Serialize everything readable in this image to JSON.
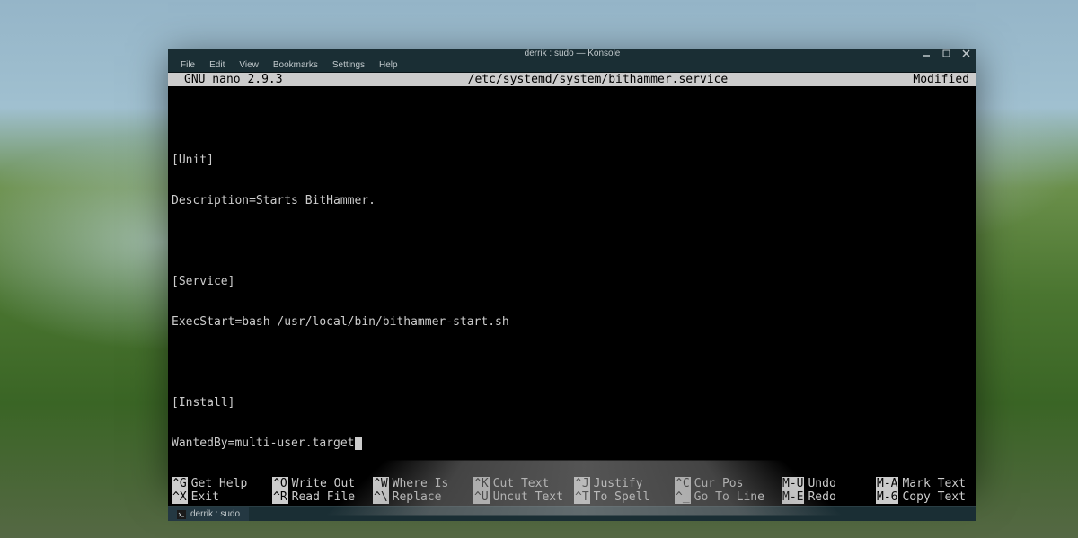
{
  "window": {
    "title": "derrik : sudo — Konsole"
  },
  "menubar": {
    "items": [
      "File",
      "Edit",
      "View",
      "Bookmarks",
      "Settings",
      "Help"
    ]
  },
  "nano": {
    "header": {
      "version": "GNU nano 2.9.3",
      "filename": "/etc/systemd/system/bithammer.service",
      "status": "Modified"
    },
    "content": {
      "lines": [
        "",
        "[Unit]",
        "Description=Starts BitHammer.",
        "",
        "[Service]",
        "ExecStart=bash /usr/local/bin/bithammer-start.sh",
        "",
        "[Install]",
        "WantedBy=multi-user.target"
      ]
    },
    "shortcuts": {
      "row1": [
        {
          "key": "^G",
          "desc": "Get Help"
        },
        {
          "key": "^O",
          "desc": "Write Out"
        },
        {
          "key": "^W",
          "desc": "Where Is"
        },
        {
          "key": "^K",
          "desc": "Cut Text"
        },
        {
          "key": "^J",
          "desc": "Justify"
        },
        {
          "key": "^C",
          "desc": "Cur Pos"
        },
        {
          "key": "M-U",
          "desc": "Undo"
        },
        {
          "key": "M-A",
          "desc": "Mark Text"
        }
      ],
      "row2": [
        {
          "key": "^X",
          "desc": "Exit"
        },
        {
          "key": "^R",
          "desc": "Read File"
        },
        {
          "key": "^\\",
          "desc": "Replace"
        },
        {
          "key": "^U",
          "desc": "Uncut Text"
        },
        {
          "key": "^T",
          "desc": "To Spell"
        },
        {
          "key": "^_",
          "desc": "Go To Line"
        },
        {
          "key": "M-E",
          "desc": "Redo"
        },
        {
          "key": "M-6",
          "desc": "Copy Text"
        }
      ]
    }
  },
  "tabstrip": {
    "tab_label": "derrik : sudo"
  }
}
